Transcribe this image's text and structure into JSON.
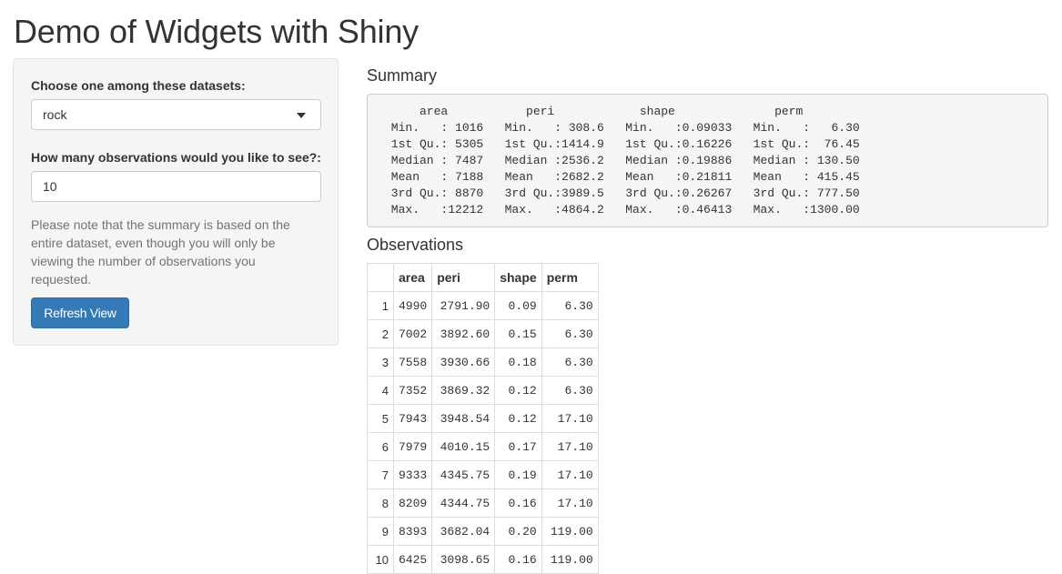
{
  "page": {
    "title": "Demo of Widgets with Shiny"
  },
  "sidebar": {
    "dataset_label": "Choose one among these datasets:",
    "dataset_selected": "rock",
    "obs_label": "How many observations would you like to see?:",
    "obs_value": "10",
    "help_text": "Please note that the summary is based on the entire dataset, even though you will only be viewing the number of observations you requested.",
    "refresh_label": "Refresh View",
    "colors": {
      "button": "#337ab7",
      "panel": "#f5f5f5"
    }
  },
  "main": {
    "summary_title": "Summary",
    "summary_text": "     area           peri            shape              perm        \n Min.   : 1016   Min.   : 308.6   Min.   :0.09033   Min.   :   6.30  \n 1st Qu.: 5305   1st Qu.:1414.9   1st Qu.:0.16226   1st Qu.:  76.45  \n Median : 7487   Median :2536.2   Median :0.19886   Median : 130.50  \n Mean   : 7188   Mean   :2682.2   Mean   :0.21811   Mean   : 415.45  \n 3rd Qu.: 8870   3rd Qu.:3989.5   3rd Qu.:0.26267   3rd Qu.: 777.50  \n Max.   :12212   Max.   :4864.2   Max.   :0.46413   Max.   :1300.00  ",
    "observations_title": "Observations",
    "table": {
      "headers": [
        "",
        "area",
        "peri",
        "shape",
        "perm"
      ],
      "rows": [
        [
          "1",
          "4990",
          "2791.90",
          "0.09",
          "6.30"
        ],
        [
          "2",
          "7002",
          "3892.60",
          "0.15",
          "6.30"
        ],
        [
          "3",
          "7558",
          "3930.66",
          "0.18",
          "6.30"
        ],
        [
          "4",
          "7352",
          "3869.32",
          "0.12",
          "6.30"
        ],
        [
          "5",
          "7943",
          "3948.54",
          "0.12",
          "17.10"
        ],
        [
          "6",
          "7979",
          "4010.15",
          "0.17",
          "17.10"
        ],
        [
          "7",
          "9333",
          "4345.75",
          "0.19",
          "17.10"
        ],
        [
          "8",
          "8209",
          "4344.75",
          "0.16",
          "17.10"
        ],
        [
          "9",
          "8393",
          "3682.04",
          "0.20",
          "119.00"
        ],
        [
          "10",
          "6425",
          "3098.65",
          "0.16",
          "119.00"
        ]
      ]
    }
  }
}
